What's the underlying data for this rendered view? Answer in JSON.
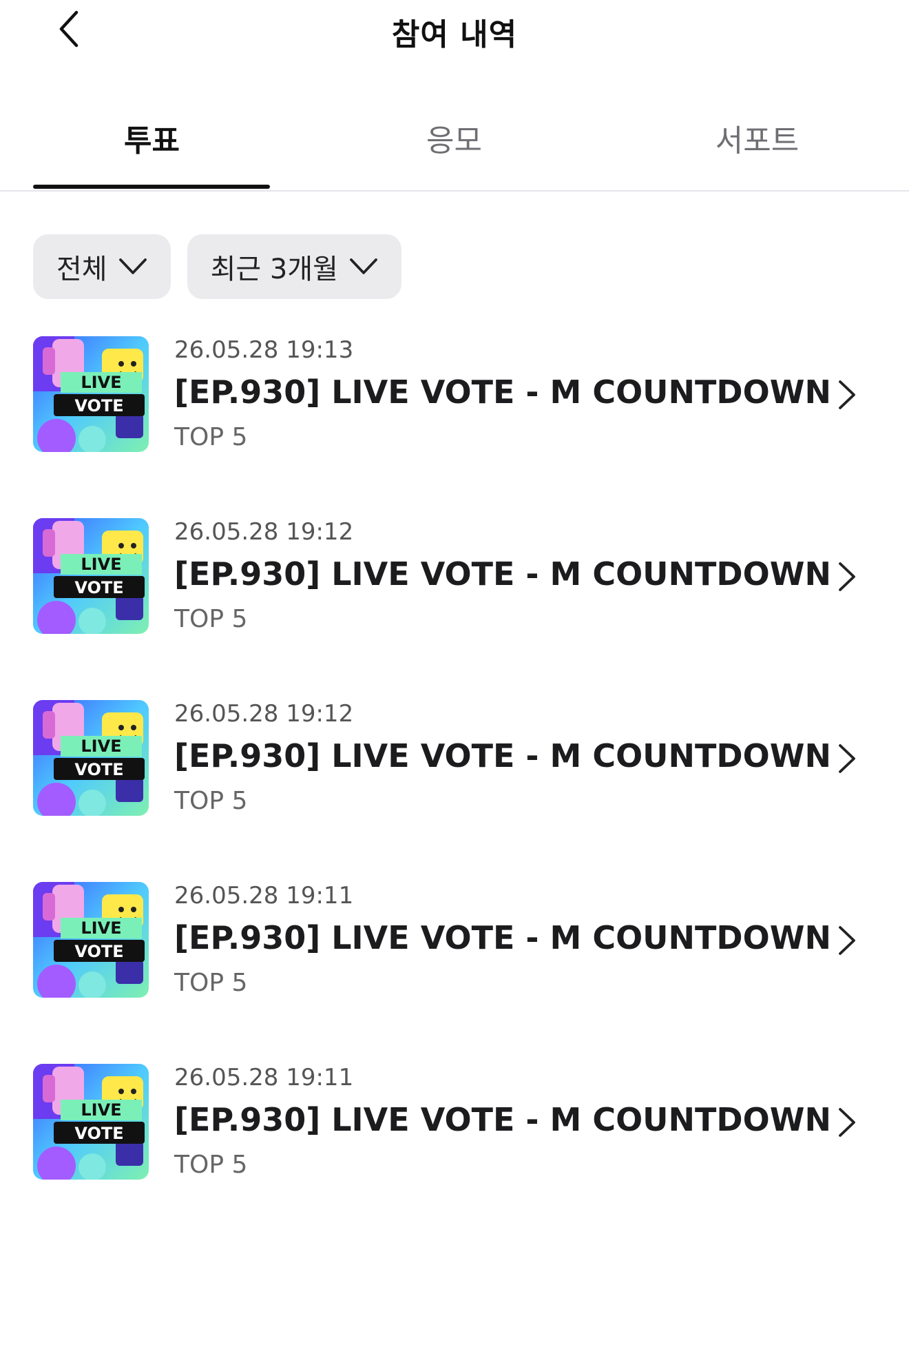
{
  "header": {
    "title": "참여 내역",
    "back_icon": "chevron-left-icon"
  },
  "tabs": [
    {
      "label": "투표",
      "active": true
    },
    {
      "label": "응모",
      "active": false
    },
    {
      "label": "서포트",
      "active": false
    }
  ],
  "filters": [
    {
      "label": "전체",
      "icon": "chevron-down-icon"
    },
    {
      "label": "최근 3개월",
      "icon": "chevron-down-icon"
    }
  ],
  "items": [
    {
      "date": "26.05.28 19:13",
      "title": "[EP.930] LIVE VOTE - M COUNTDOWN",
      "subtitle": "TOP 5",
      "thumb_text_1": "LIVE",
      "thumb_text_2": "VOTE"
    },
    {
      "date": "26.05.28 19:12",
      "title": "[EP.930] LIVE VOTE - M COUNTDOWN",
      "subtitle": "TOP 5",
      "thumb_text_1": "LIVE",
      "thumb_text_2": "VOTE"
    },
    {
      "date": "26.05.28 19:12",
      "title": "[EP.930] LIVE VOTE - M COUNTDOWN",
      "subtitle": "TOP 5",
      "thumb_text_1": "LIVE",
      "thumb_text_2": "VOTE"
    },
    {
      "date": "26.05.28 19:11",
      "title": "[EP.930] LIVE VOTE - M COUNTDOWN",
      "subtitle": "TOP 5",
      "thumb_text_1": "LIVE",
      "thumb_text_2": "VOTE"
    },
    {
      "date": "26.05.28 19:11",
      "title": "[EP.930] LIVE VOTE - M COUNTDOWN",
      "subtitle": "TOP 5",
      "thumb_text_1": "LIVE",
      "thumb_text_2": "VOTE"
    }
  ],
  "colors": {
    "chip_bg": "#ebebee",
    "active_tab": "#111111",
    "inactive_tab": "#6e6e73",
    "divider": "#e5e5ea"
  }
}
